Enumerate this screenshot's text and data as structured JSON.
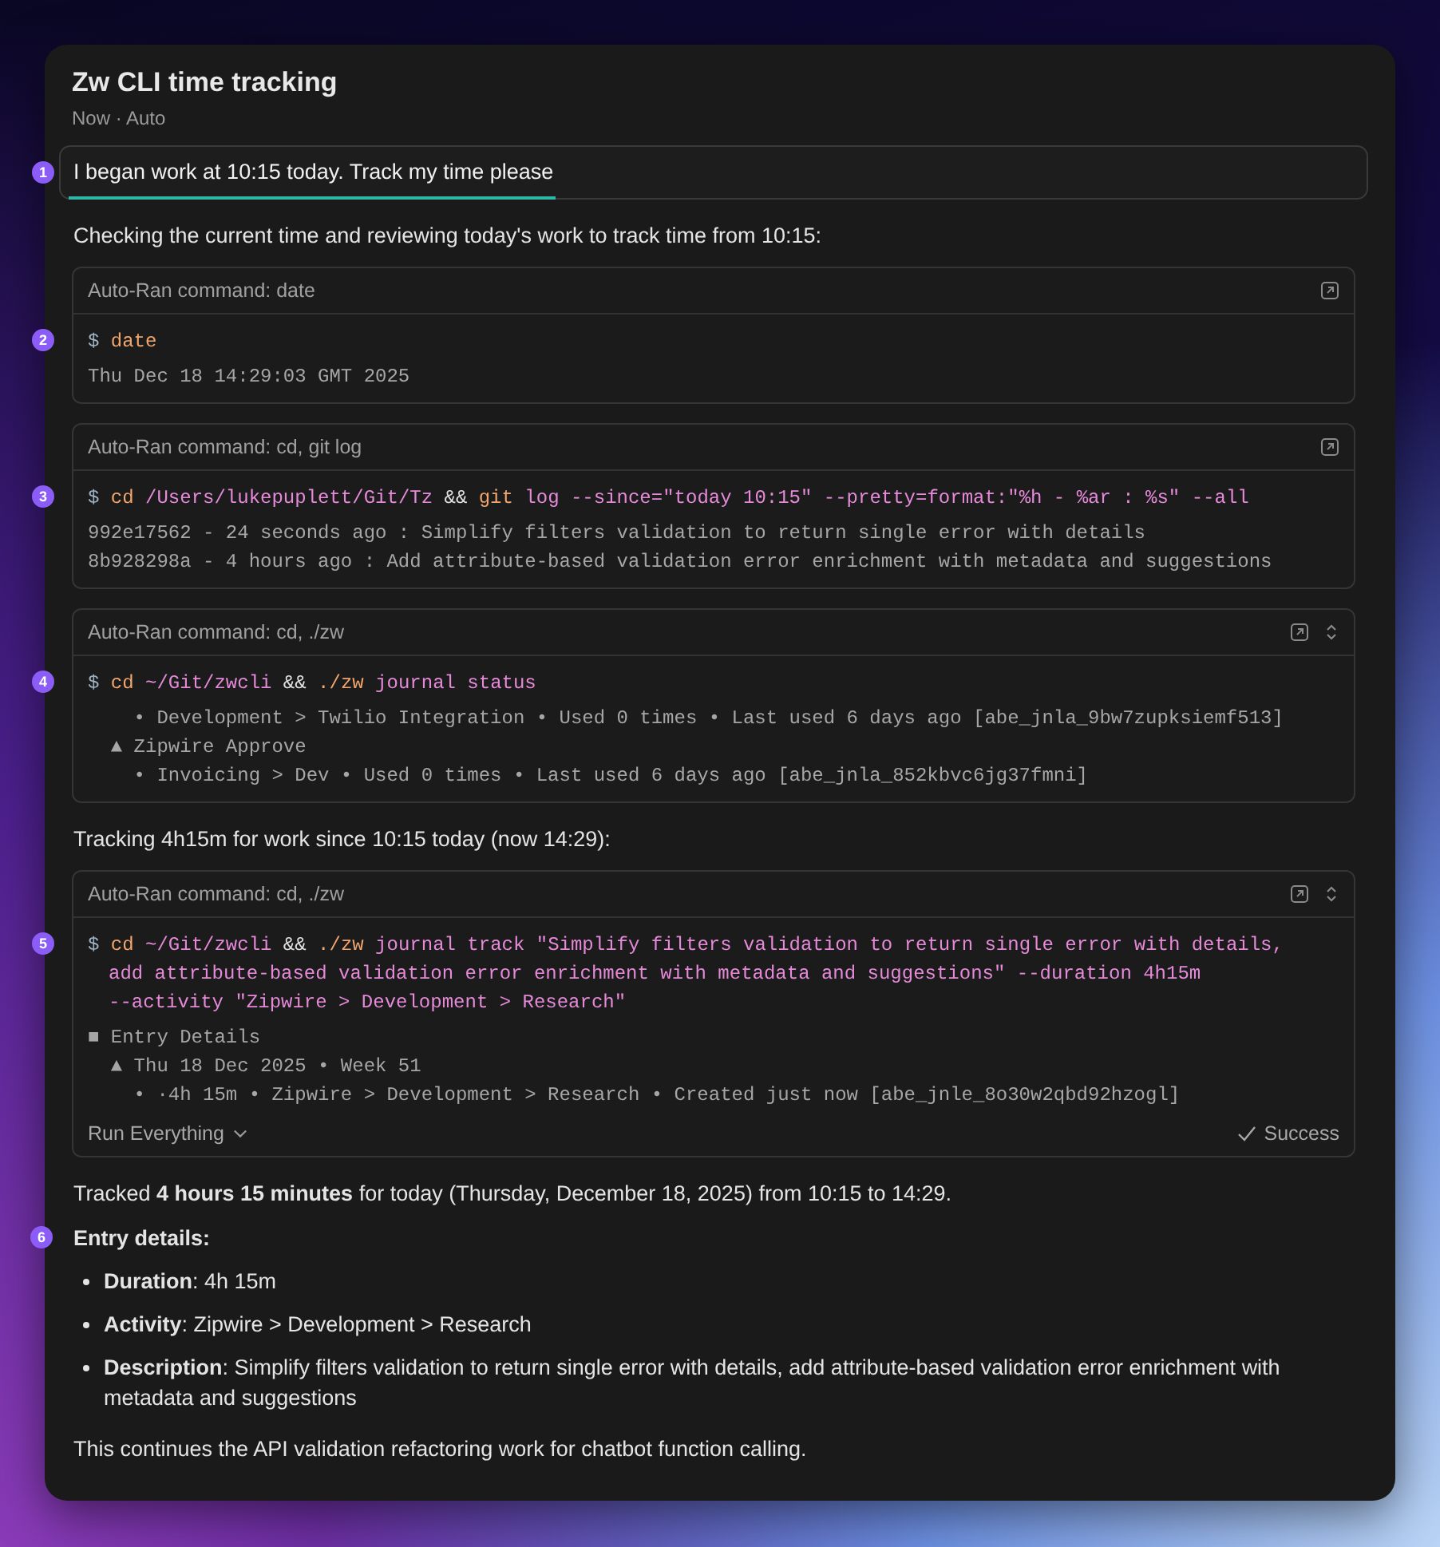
{
  "header": {
    "title": "Zw CLI time tracking",
    "subtitle": "Now · Auto"
  },
  "messages": [
    {
      "kind": "user",
      "marker": "1",
      "text": "I began work at 10:15 today. Track my time please"
    },
    {
      "kind": "text",
      "paragraphs": [
        {
          "kind": "para",
          "text": "Checking the current time and reviewing today's work to track time from 10:15:"
        }
      ]
    },
    {
      "kind": "command",
      "title": "Auto-Ran command: date",
      "expandable": false,
      "marker": "2",
      "command": [
        [
          {
            "t": "$",
            "kind": "prompt"
          },
          {
            "t": "date",
            "kind": "program"
          }
        ]
      ],
      "output": [
        "Thu Dec 18 14:29:03 GMT 2025"
      ]
    },
    {
      "kind": "command",
      "title": "Auto-Ran command: cd, git log",
      "expandable": false,
      "marker": "3",
      "command": [
        [
          {
            "t": "$",
            "kind": "prompt"
          },
          {
            "t": "cd",
            "kind": "program"
          },
          {
            "t": "/Users/lukepuplett/Git/Tz",
            "kind": "arg"
          },
          {
            "t": "&&",
            "kind": "op"
          },
          {
            "t": "git",
            "kind": "program"
          },
          {
            "t": "log --since=\"today 10:15\" --pretty=format:\"%h - %ar : %s\" --all",
            "kind": "arg"
          }
        ]
      ],
      "output": [
        "992e17562 - 24 seconds ago : Simplify filters validation to return single error with details",
        "8b928298a - 4 hours ago : Add attribute-based validation error enrichment with metadata and suggestions"
      ]
    },
    {
      "kind": "command",
      "title": "Auto-Ran command: cd, ./zw",
      "expandable": true,
      "marker": "4",
      "command": [
        [
          {
            "t": "$",
            "kind": "prompt"
          },
          {
            "t": "cd",
            "kind": "program"
          },
          {
            "t": "~/Git/zwcli",
            "kind": "arg"
          },
          {
            "t": "&&",
            "kind": "op"
          },
          {
            "t": "./zw",
            "kind": "program"
          },
          {
            "t": "journal status",
            "kind": "arg"
          }
        ]
      ],
      "output": [
        "    • Development > Twilio Integration • Used 0 times • Last used 6 days ago [abe_jnla_9bw7zupksiemf513]",
        "  ▲ Zipwire Approve",
        "    • Invoicing > Dev • Used 0 times • Last used 6 days ago [abe_jnla_852kbvc6jg37fmni]"
      ]
    },
    {
      "kind": "text",
      "paragraphs": [
        {
          "kind": "para",
          "text": "Tracking 4h15m for work since 10:15 today (now 14:29):"
        }
      ]
    },
    {
      "kind": "command",
      "title": "Auto-Ran command: cd, ./zw",
      "expandable": true,
      "marker": "5",
      "command": [
        [
          {
            "t": "$",
            "kind": "prompt"
          },
          {
            "t": "cd",
            "kind": "program"
          },
          {
            "t": "~/Git/zwcli",
            "kind": "arg"
          },
          {
            "t": "&&",
            "kind": "op"
          },
          {
            "t": "./zw",
            "kind": "program"
          },
          {
            "t": "journal track \"Simplify filters validation to return single error with details,",
            "kind": "arg"
          }
        ],
        [
          {
            "t": "add attribute-based validation error enrichment with metadata and suggestions\" --duration 4h15m",
            "kind": "arg"
          }
        ],
        [
          {
            "t": "--activity \"Zipwire > Development > Research\"",
            "kind": "arg"
          }
        ]
      ],
      "output": [
        "■ Entry Details",
        "  ▲ Thu 18 Dec 2025 • Week 51",
        "    • ·4h 15m • Zipwire > Development > Research • Created just now [abe_jnle_8o30w2qbd92hzogl]"
      ],
      "footer": {
        "run": "Run Everything",
        "status": "Success"
      }
    },
    {
      "kind": "text",
      "paragraphs": [
        {
          "kind": "para",
          "text": "Tracked **4 hours 15 minutes** for today (Thursday, December 18, 2025) from 10:15 to 14:29."
        },
        {
          "kind": "heading",
          "marker": "6",
          "text": "Entry details:"
        },
        {
          "kind": "bullet",
          "text": "**Duration**: 4h 15m"
        },
        {
          "kind": "bullet",
          "text": "**Activity**: Zipwire > Development > Research"
        },
        {
          "kind": "bullet",
          "text": "**Description**: Simplify filters validation to return single error with details, add attribute-based validation error enrichment with metadata and suggestions"
        },
        {
          "kind": "para",
          "text": "This continues the API validation refactoring work for chatbot function calling."
        }
      ]
    }
  ]
}
